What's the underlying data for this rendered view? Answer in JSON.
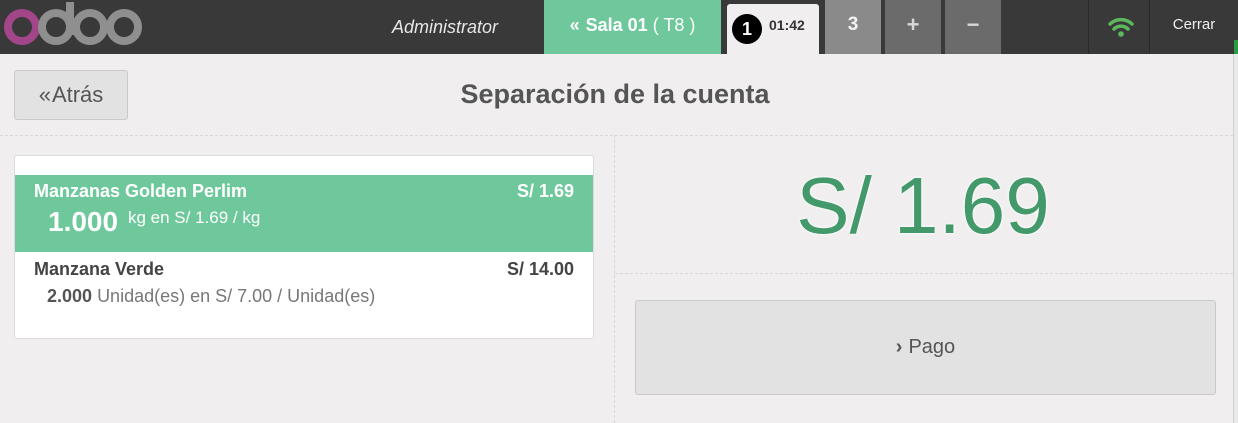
{
  "topbar": {
    "logo_text": "odoo",
    "user": "Administrator",
    "floor_tab": {
      "label": "Sala 01",
      "table": "( T8 )"
    },
    "order_tab": {
      "number": "1",
      "time": "01:42"
    },
    "customer_count": "3",
    "add_label": "+",
    "remove_label": "−",
    "wifi_icon": "wifi-icon",
    "close_label": "Cerrar",
    "colors": {
      "bar": "#393939",
      "accent": "#6ec89b",
      "wifi": "#5cb85c",
      "logo_o": "#a24689"
    }
  },
  "header": {
    "back_label": "Atrás",
    "title": "Separación de la cuenta"
  },
  "orderlines": [
    {
      "product": "Manzanas Golden Perlim",
      "price": "S/ 1.69",
      "quantity": "1.000",
      "unit_info": "kg en S/ 1.69 / kg",
      "selected": true
    },
    {
      "product": "Manzana Verde",
      "price": "S/ 14.00",
      "quantity": "2.000",
      "unit_info": "Unidad(es) en S/ 7.00 / Unidad(es)",
      "selected": false
    }
  ],
  "summary": {
    "total": "S/ 1.69",
    "pay_label": "Pago",
    "total_color": "#43996a"
  }
}
